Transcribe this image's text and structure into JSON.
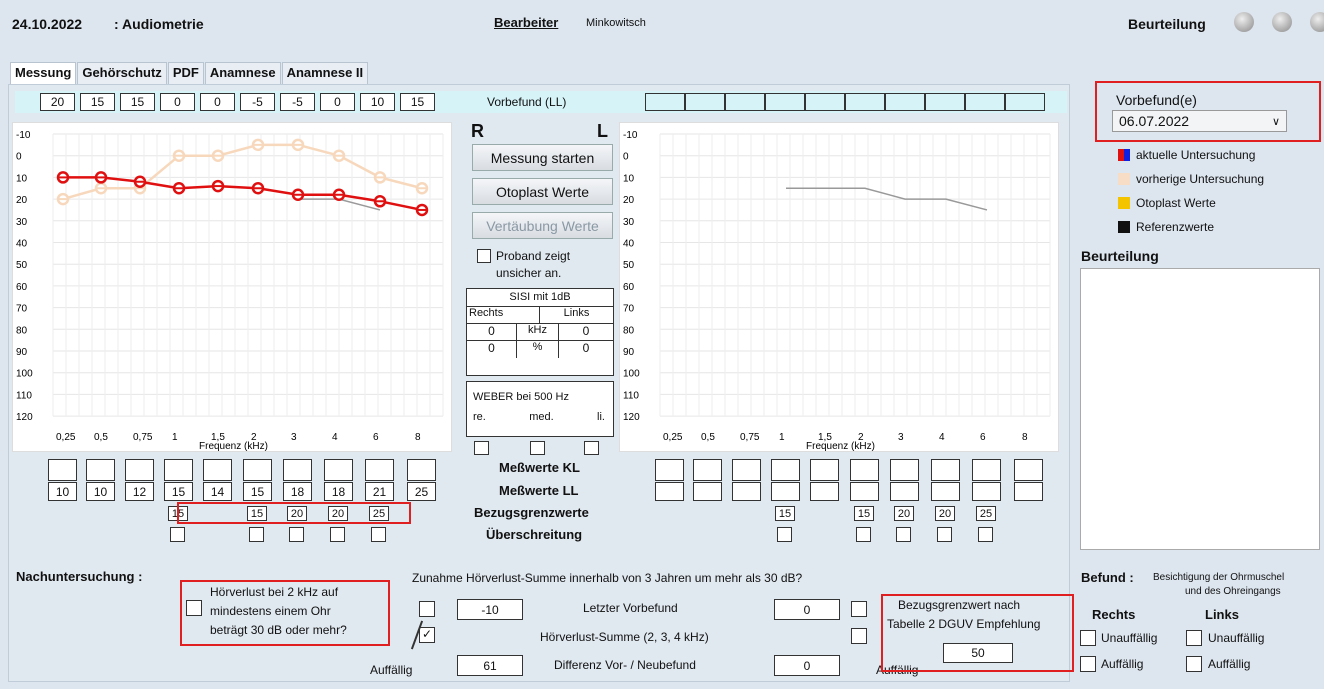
{
  "header": {
    "date": "24.10.2022",
    "title": ": Audiometrie",
    "editor_label": "Bearbeiter",
    "editor_name": "Minkowitsch",
    "rating_label": "Beurteilung"
  },
  "tabs": [
    "Messung",
    "Gehörschutz",
    "PDF",
    "Anamnese",
    "Anamnese II"
  ],
  "vorbefund_strip": {
    "label": "Vorbefund (LL)",
    "right_values": [
      "20",
      "15",
      "15",
      "0",
      "0",
      "-5",
      "-5",
      "0",
      "10",
      "15"
    ],
    "left_values": [
      "",
      "",
      "",
      "",
      "",
      "",
      "",
      "",
      "",
      ""
    ]
  },
  "y_labels": [
    "-10",
    "0",
    "10",
    "20",
    "30",
    "40",
    "50",
    "60",
    "70",
    "80",
    "90",
    "100",
    "110",
    "120"
  ],
  "x_labels": [
    "0,25",
    "0,5",
    "0,75",
    "1",
    "1,5",
    "2",
    "3",
    "4",
    "6",
    "8"
  ],
  "x_axis_title": "Frequenz (kHz)",
  "side_labels": {
    "r": "R",
    "l": "L"
  },
  "buttons": {
    "start": "Messung starten",
    "otoplast": "Otoplast Werte",
    "vertaeubung": "Vertäubung Werte"
  },
  "proband": {
    "line1": "Proband zeigt",
    "line2": "unsicher an."
  },
  "sisi": {
    "title": "SISI mit 1dB",
    "rechts": "Rechts",
    "links": "Links",
    "r1": "0",
    "u1": "kHz",
    "l1": "0",
    "r2": "0",
    "u2": "%",
    "l2": "0"
  },
  "weber": {
    "title": "WEBER bei 500 Hz",
    "re": "re.",
    "med": "med.",
    "li": "li."
  },
  "row_labels": {
    "kl": "Meßwerte KL",
    "ll": "Meßwerte LL",
    "bgw": "Bezugsgrenzwerte",
    "ueb": "Überschreitung"
  },
  "right_ear": {
    "kl": [
      "",
      "",
      "",
      "",
      "",
      "",
      "",
      "",
      "",
      ""
    ],
    "ll": [
      "10",
      "10",
      "12",
      "15",
      "14",
      "15",
      "18",
      "18",
      "21",
      "25"
    ],
    "bgw": [
      "",
      "",
      "",
      "15",
      "",
      "15",
      "20",
      "20",
      "25",
      ""
    ]
  },
  "left_ear": {
    "kl": [
      "",
      "",
      "",
      "",
      "",
      "",
      "",
      "",
      "",
      ""
    ],
    "ll": [
      "",
      "",
      "",
      "",
      "",
      "",
      "",
      "",
      "",
      ""
    ],
    "bgw": [
      "",
      "",
      "",
      "15",
      "",
      "15",
      "20",
      "20",
      "25",
      ""
    ]
  },
  "chart_data": {
    "type": "line",
    "x": [
      "0,25",
      "0,5",
      "0,75",
      "1",
      "1,5",
      "2",
      "3",
      "4",
      "6",
      "8"
    ],
    "ylim": [
      -10,
      120
    ],
    "y_inverted": true,
    "series": [
      {
        "name": "aktuelle Untersuchung",
        "ear": "right",
        "values": [
          10,
          10,
          12,
          15,
          14,
          15,
          18,
          18,
          21,
          25
        ]
      },
      {
        "name": "vorherige Untersuchung",
        "ear": "right",
        "values": [
          20,
          15,
          15,
          0,
          0,
          -5,
          -5,
          0,
          10,
          15
        ]
      },
      {
        "name": "Referenzwerte",
        "ear": "right",
        "values": [
          null,
          null,
          null,
          null,
          null,
          null,
          20,
          20,
          25,
          null
        ]
      },
      {
        "name": "Referenzwerte",
        "ear": "left",
        "values": [
          null,
          null,
          null,
          15,
          null,
          15,
          20,
          20,
          25,
          null
        ]
      }
    ]
  },
  "vorbefund": {
    "label": "Vorbefund(e)",
    "selected": "06.07.2022"
  },
  "legend": [
    {
      "label": "aktuelle Untersuchung",
      "color": "#e01010"
    },
    {
      "label": "vorherige Untersuchung",
      "color": "#f7dcc6"
    },
    {
      "label": "Otoplast Werte",
      "color": "#f5c400"
    },
    {
      "label": "Referenzwerte",
      "color": "#111111"
    }
  ],
  "beurteilung_title": "Beurteilung",
  "nachuntersuchung": {
    "label": "Nachuntersuchung :",
    "hv_text1": "Hörverlust bei 2 kHz auf",
    "hv_text2": "mindestens einem Ohr",
    "hv_text3": "beträgt 30 dB oder mehr?"
  },
  "zunahme": {
    "question": "Zunahme Hörverlust-Summe innerhalb von 3 Jahren um mehr als 30 dB?",
    "letzter": "Letzter Vorbefund",
    "summe": "Hörverlust-Summe (2, 3, 4 kHz)",
    "differenz": "Differenz Vor- / Neubefund",
    "auffaellig": "Auffällig",
    "r_letzter": "-10",
    "r_differenz": "61",
    "l_letzter": "0",
    "l_differenz": "0",
    "auffaellig_r": "Auffällig"
  },
  "bezug": {
    "text1": "Bezugsgrenzwert nach",
    "text2": "Tabelle 2 DGUV Empfehlung",
    "value": "50"
  },
  "befund": {
    "label": "Befund :",
    "desc1": "Besichtigung der Ohrmuschel",
    "desc2": "und des Ohreingangs",
    "rechts": "Rechts",
    "links": "Links",
    "unauffaellig": "Unauffällig",
    "auffaellig": "Auffällig"
  }
}
